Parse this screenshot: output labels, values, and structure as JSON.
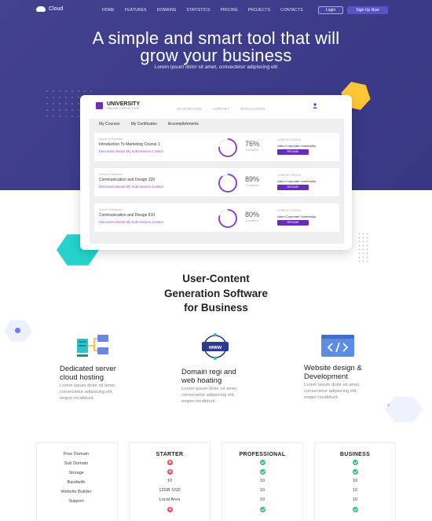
{
  "nav": {
    "brand": "Cloud",
    "links": [
      "HOME",
      "FEATURES",
      "DOMAINS",
      "STATISTICS",
      "PRICING",
      "PROJECTS",
      "CONTACTS"
    ],
    "login": "Login",
    "signup": "Sign Up Now"
  },
  "hero": {
    "title_line1": "A simple and smart tool that will",
    "title_line2": "grow your business",
    "subtitle": "Lorem ipsum dolor sit amet, consectetur adipiscing elit"
  },
  "dashboard": {
    "brand": "UNIVERSITY",
    "brand_sub": "ONLINE CERTIFICATE",
    "nav": [
      "DASHBOARD",
      "LIBRARY",
      "DISCUSSION"
    ],
    "tabs": [
      "My Courses",
      "My Certificates",
      "Accomplishments"
    ],
    "courses": [
      {
        "category": "School of Business",
        "title": "Introduction To Marketing Course 1",
        "links": "Discussion Board   My Submissions   Contact",
        "percent": 76,
        "percent_label": "76%",
        "completion": "Completion",
        "current_label": "CURRENT LESSON",
        "current_value": "video:Corporate Leadership",
        "resume": "RESUME"
      },
      {
        "category": "School of Business",
        "title": "Communication and Design 320",
        "links": "Discussion Board   My Submissions   Contact",
        "percent": 89,
        "percent_label": "89%",
        "completion": "Completion",
        "current_label": "CURRENT LESSON",
        "current_value": "video:Corporate Leadership",
        "resume": "RESUME"
      },
      {
        "category": "School of Business",
        "title": "Communication and Design 810",
        "links": "Discussion Board   My Submissions   Contact",
        "percent": 80,
        "percent_label": "80%",
        "completion": "Completion",
        "current_label": "CURRENT LESSON",
        "current_value": "video:Corporate Leadership",
        "resume": "RESUME"
      }
    ]
  },
  "section": {
    "line1": "User-Content",
    "line2": "Generation Software",
    "line3": "for Business"
  },
  "features": [
    {
      "icon": "server-network-icon",
      "title1": "Dedicated server",
      "title2": "cloud hosting",
      "text1": "Lorem ipsum dolor sit amet,",
      "text2": "consectetur adipiscing elit,",
      "text3": "empor incididunt."
    },
    {
      "icon": "www-globe-icon",
      "title1": "Domain regi and",
      "title2": "web hoating",
      "text1": "Lorem ipsum dolor sit amet,",
      "text2": "consectetur adipiscing elit,",
      "text3": "empor incididunt."
    },
    {
      "icon": "code-window-icon",
      "title1": "Website design &",
      "title2": "Development",
      "text1": "Lorem ipsum dolor sit amet,",
      "text2": "consectetur adipiscing elit,",
      "text3": "empor incididunt."
    }
  ],
  "pricing": {
    "rows": [
      "Free Domain",
      "Sub Domain",
      "Storage",
      "Bandwith",
      "Website Builder",
      "Support"
    ],
    "plans": [
      {
        "name": "STARTER",
        "cells": [
          "no",
          "no",
          "10",
          "12GB SSD",
          "Local Area",
          "no"
        ]
      },
      {
        "name": "PROFESSIONAL",
        "cells": [
          "ok",
          "ok",
          "10",
          "10",
          "10",
          "ok"
        ]
      },
      {
        "name": "BUSINESS",
        "cells": [
          "ok",
          "ok",
          "10",
          "10",
          "10",
          "ok"
        ]
      }
    ]
  },
  "colors": {
    "hero_bg": "#3b3a8c",
    "accent_purple": "#6a2bb8",
    "ring_purple": "#8e44c9",
    "yellow": "#ffc736",
    "teal": "#24d4cc",
    "check_green": "#2ec27e",
    "cross_red": "#ec4a52"
  }
}
